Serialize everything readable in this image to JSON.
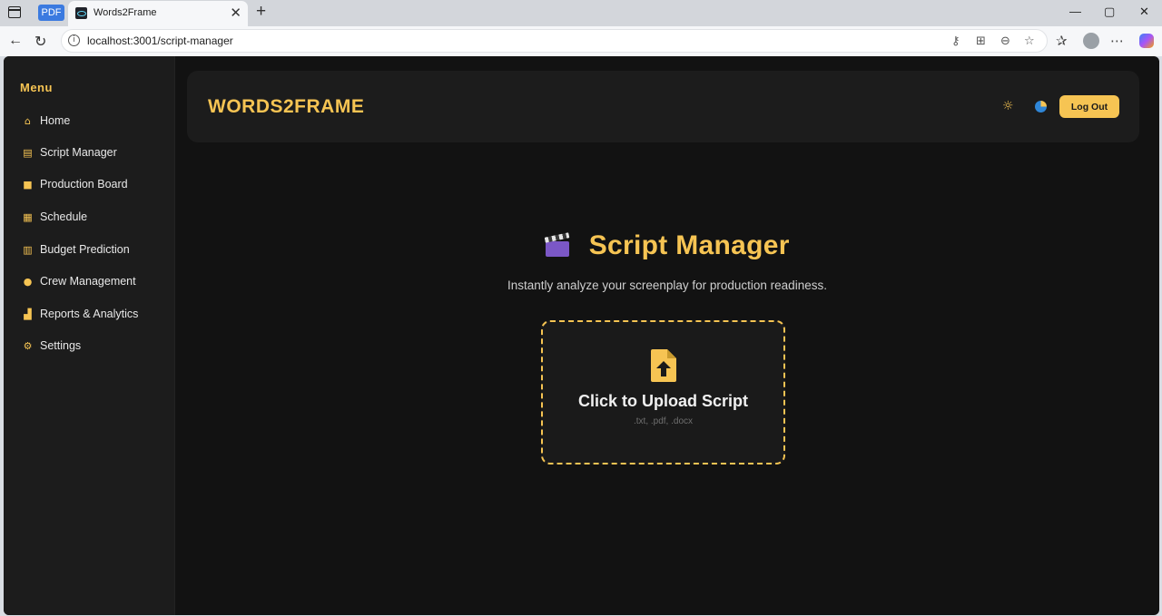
{
  "browser": {
    "pdf_tab_label": "PDF",
    "tab_title": "Words2Frame",
    "tab_close": "✕",
    "new_tab": "+",
    "url": "localhost:3001/script-manager",
    "window_controls": {
      "minimize": "—",
      "maximize": "▢",
      "close": "✕"
    }
  },
  "sidebar": {
    "title": "Menu",
    "items": [
      {
        "label": "Home",
        "icon": "home-icon",
        "glyph": "⌂"
      },
      {
        "label": "Script Manager",
        "icon": "file-text-icon",
        "glyph": "▤"
      },
      {
        "label": "Production Board",
        "icon": "video-camera-icon",
        "glyph": "■"
      },
      {
        "label": "Schedule",
        "icon": "calendar-icon",
        "glyph": "▦"
      },
      {
        "label": "Budget Prediction",
        "icon": "calculator-icon",
        "glyph": "▥"
      },
      {
        "label": "Crew Management",
        "icon": "users-icon",
        "glyph": "●"
      },
      {
        "label": "Reports & Analytics",
        "icon": "chart-bar-icon",
        "glyph": "▟"
      },
      {
        "label": "Settings",
        "icon": "gear-icon",
        "glyph": "⚙"
      }
    ]
  },
  "header": {
    "brand": "WORDS2FRAME",
    "logout_label": "Log Out"
  },
  "main": {
    "title": "Script Manager",
    "subtitle": "Instantly analyze your screenplay for production readiness.",
    "upload": {
      "label": "Click to Upload Script",
      "types": ".txt, .pdf, .docx"
    }
  },
  "colors": {
    "accent": "#f6c453",
    "background": "#121212",
    "panel": "#1c1c1c"
  }
}
